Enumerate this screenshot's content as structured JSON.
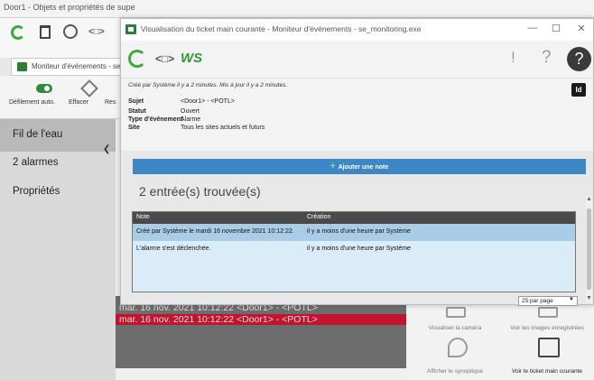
{
  "background_window": {
    "title": "Door1 - Objets et propriétés de supe",
    "tab_label": "Moniteur d'événements - se",
    "ribbon": {
      "scroll_label": "Défilement auto.",
      "clear_label": "Effacer",
      "reset_label": "Res"
    },
    "sidebar": {
      "items": [
        {
          "label": "Fil de l'eau"
        },
        {
          "label": "2 alarmes"
        },
        {
          "label": "Propriétés"
        }
      ]
    },
    "log_lines": [
      {
        "text": "mar. 16 nov. 2021 10:12:22    <Door1> - <POTL>"
      },
      {
        "text": "mar. 16 nov. 2021 10:12:22    <Door1> - <POTL>"
      }
    ],
    "actions": [
      {
        "label": "Visualiser la caméra"
      },
      {
        "label": "Voir les images enregistrées"
      },
      {
        "label": "Afficher le synoptique"
      },
      {
        "label": "Voir le ticket main courante"
      }
    ]
  },
  "modal": {
    "title": "Visualisation du ticket main courante - Moniteur d'événements - se_monitoring.exe",
    "window_controls": {
      "minimize": "—",
      "maximize": "☐",
      "close": "✕"
    },
    "toolbar": {
      "logo": "WS",
      "link_glyph": "<□>",
      "alert_glyph": "!",
      "help_glyph": "?"
    },
    "info": {
      "created_text": "Créé par Système il y a 2 minutes. Mis à jour il y a 2 minutes.",
      "id_badge": "Id",
      "fields": [
        {
          "label": "Sujet",
          "value": "<Door1> - <POTL>"
        },
        {
          "label": "Statut",
          "value": "Ouvert"
        },
        {
          "label": "Type d'événement",
          "value": "Alarme"
        },
        {
          "label": "Site",
          "value": "Tous les sites actuels et futurs"
        }
      ]
    },
    "add_note_label": "Ajouter une note",
    "entries_found": "2 entrée(s) trouvée(s)",
    "table": {
      "headers": [
        "Note",
        "Création"
      ],
      "rows": [
        [
          "Créé par Système le mardi 16 novembre 2021 10:12:22.",
          "il y a moins d'une heure par Système"
        ],
        [
          "L'alarme s'est déclenchée.",
          "il y a moins d'une heure par Système"
        ]
      ]
    },
    "per_page": "25 par page"
  },
  "colors": {
    "accent_blue": "#3d87c7",
    "brand_green": "#2e9a3a",
    "alarm_red": "#c3142d",
    "selected_row": "#a9cde6"
  }
}
